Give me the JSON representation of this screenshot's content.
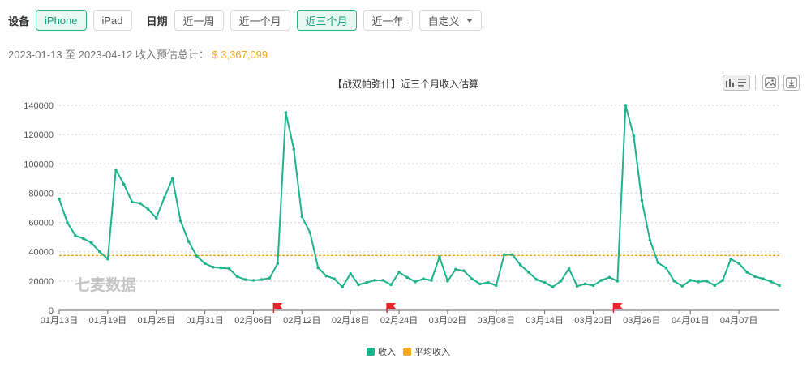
{
  "filters": {
    "device_label": "设备",
    "devices": [
      {
        "label": "iPhone",
        "active": true
      },
      {
        "label": "iPad",
        "active": false
      }
    ],
    "date_label": "日期",
    "ranges": [
      {
        "label": "近一周",
        "active": false
      },
      {
        "label": "近一个月",
        "active": false
      },
      {
        "label": "近三个月",
        "active": true
      },
      {
        "label": "近一年",
        "active": false
      }
    ],
    "custom_label": "自定义"
  },
  "summary": {
    "text": "2023-01-13 至 2023-04-12 收入预估总计：",
    "total": "$ 3,367,099"
  },
  "toolbox": {
    "icons": [
      "bar-chart-icon",
      "list-icon",
      "save-image-icon",
      "download-icon"
    ]
  },
  "watermark": "七麦数据",
  "colors": {
    "revenue": "#1eb38a",
    "average": "#f7a821",
    "marker": "#e8262a",
    "accent": "#20b486"
  },
  "chart_data": {
    "type": "line",
    "title": "【战双帕弥什】近三个月收入估算",
    "x": [
      "01月13日",
      "01月14日",
      "01月15日",
      "01月16日",
      "01月17日",
      "01月18日",
      "01月19日",
      "01月20日",
      "01月21日",
      "01月22日",
      "01月23日",
      "01月24日",
      "01月25日",
      "01月26日",
      "01月27日",
      "01月28日",
      "01月29日",
      "01月30日",
      "01月31日",
      "02月01日",
      "02月02日",
      "02月03日",
      "02月04日",
      "02月05日",
      "02月06日",
      "02月07日",
      "02月08日",
      "02月09日",
      "02月10日",
      "02月11日",
      "02月12日",
      "02月13日",
      "02月14日",
      "02月15日",
      "02月16日",
      "02月17日",
      "02月18日",
      "02月19日",
      "02月20日",
      "02月21日",
      "02月22日",
      "02月23日",
      "02月24日",
      "02月25日",
      "02月26日",
      "02月27日",
      "02月28日",
      "03月01日",
      "03月02日",
      "03月03日",
      "03月04日",
      "03月05日",
      "03月06日",
      "03月07日",
      "03月08日",
      "03月09日",
      "03月10日",
      "03月11日",
      "03月12日",
      "03月13日",
      "03月14日",
      "03月15日",
      "03月16日",
      "03月17日",
      "03月18日",
      "03月19日",
      "03月20日",
      "03月21日",
      "03月22日",
      "03月23日",
      "03月24日",
      "03月25日",
      "03月26日",
      "03月27日",
      "03月28日",
      "03月29日",
      "03月30日",
      "03月31日",
      "04月01日",
      "04月02日",
      "04月03日",
      "04月04日",
      "04月05日",
      "04月06日",
      "04月07日",
      "04月08日",
      "04月09日",
      "04月10日",
      "04月11日",
      "04月12日"
    ],
    "x_tick_labels": [
      "01月13日",
      "01月19日",
      "01月25日",
      "01月31日",
      "02月06日",
      "02月12日",
      "02月18日",
      "02月24日",
      "03月02日",
      "03月08日",
      "03月14日",
      "03月20日",
      "03月26日",
      "04月01日",
      "04月07日"
    ],
    "series": [
      {
        "name": "收入",
        "color": "#1eb38a",
        "values": [
          76000,
          60000,
          51000,
          49000,
          46000,
          40000,
          35000,
          96000,
          86000,
          74000,
          73000,
          69000,
          63000,
          77000,
          90000,
          61000,
          47000,
          37000,
          32000,
          29500,
          29000,
          28500,
          23000,
          21000,
          20500,
          21000,
          22000,
          32000,
          135000,
          110000,
          64000,
          53000,
          29000,
          23500,
          21500,
          16000,
          25000,
          17500,
          19000,
          20500,
          20500,
          17500,
          26000,
          22500,
          19500,
          21500,
          20500,
          36500,
          20000,
          28000,
          27000,
          21500,
          18000,
          19000,
          17000,
          38000,
          38000,
          31000,
          26000,
          21000,
          19000,
          16000,
          20000,
          28500,
          16500,
          18000,
          17000,
          20500,
          22500,
          20000,
          140000,
          119000,
          75000,
          48000,
          32500,
          29000,
          20000,
          16500,
          20500,
          19500,
          20000,
          17000,
          20500,
          35000,
          32000,
          26000,
          23000,
          21500,
          19500,
          17000
        ]
      },
      {
        "name": "平均收入",
        "color": "#f7a821",
        "value": 37412
      }
    ],
    "ylim": [
      0,
      140000
    ],
    "yticks": [
      0,
      20000,
      40000,
      60000,
      80000,
      100000,
      120000,
      140000
    ],
    "event_markers": [
      "02月09日",
      "02月23日",
      "03月23日"
    ],
    "legend_position": "bottom-center",
    "grid": true
  }
}
